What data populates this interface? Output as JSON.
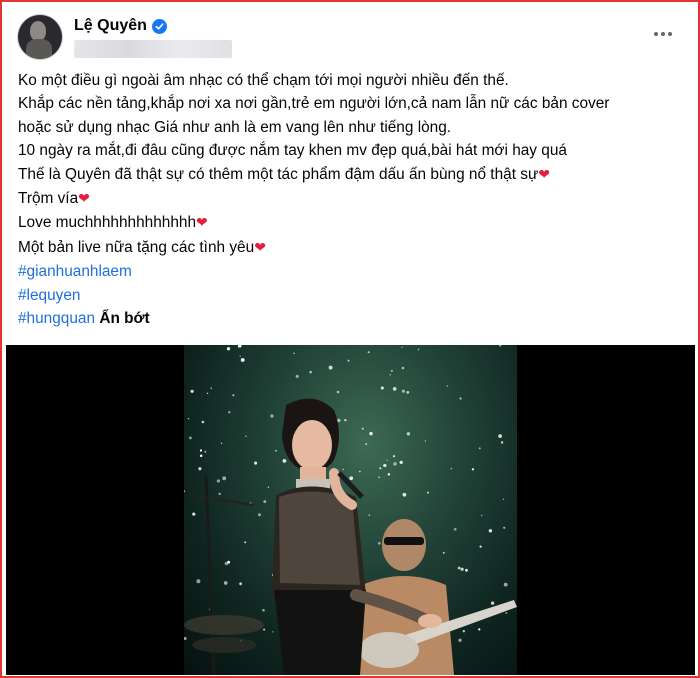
{
  "post": {
    "author": "Lệ Quyên",
    "icons": {
      "verified": "verified-badge-icon",
      "more": "more-options-icon"
    },
    "colors": {
      "accent": "#1877f2",
      "hashtag": "#216fdb",
      "heart": "#e41e3f",
      "border": "#e03535"
    },
    "lines": [
      "Ko một điều gì ngoài âm nhạc có thể chạm tới mọi người nhiều đến thế.",
      "Khắp các nền tảng,khắp nơi xa nơi gần,trẻ em người lớn,cả nam lẫn nữ các bản cover",
      "hoặc sử dụng nhạc Giá như anh là em vang lên như tiếng lòng.",
      "10 ngày ra mắt,đi đâu cũng được nắm tay khen mv đẹp quá,bài hát mới hay quá",
      "Thế là Quyên đã thật sự có thêm một tác phẩm đậm dấu ấn bùng nổ thật sự",
      "Trộm vía",
      "Love muchhhhhhhhhhhhh",
      "Một bản live nữa tặng các tình yêu"
    ],
    "heart": "❤",
    "hashtags": [
      "#gianhuanhlaem",
      "#lequyen",
      "#hungquan"
    ],
    "see_less": "Ẩn bớt"
  }
}
